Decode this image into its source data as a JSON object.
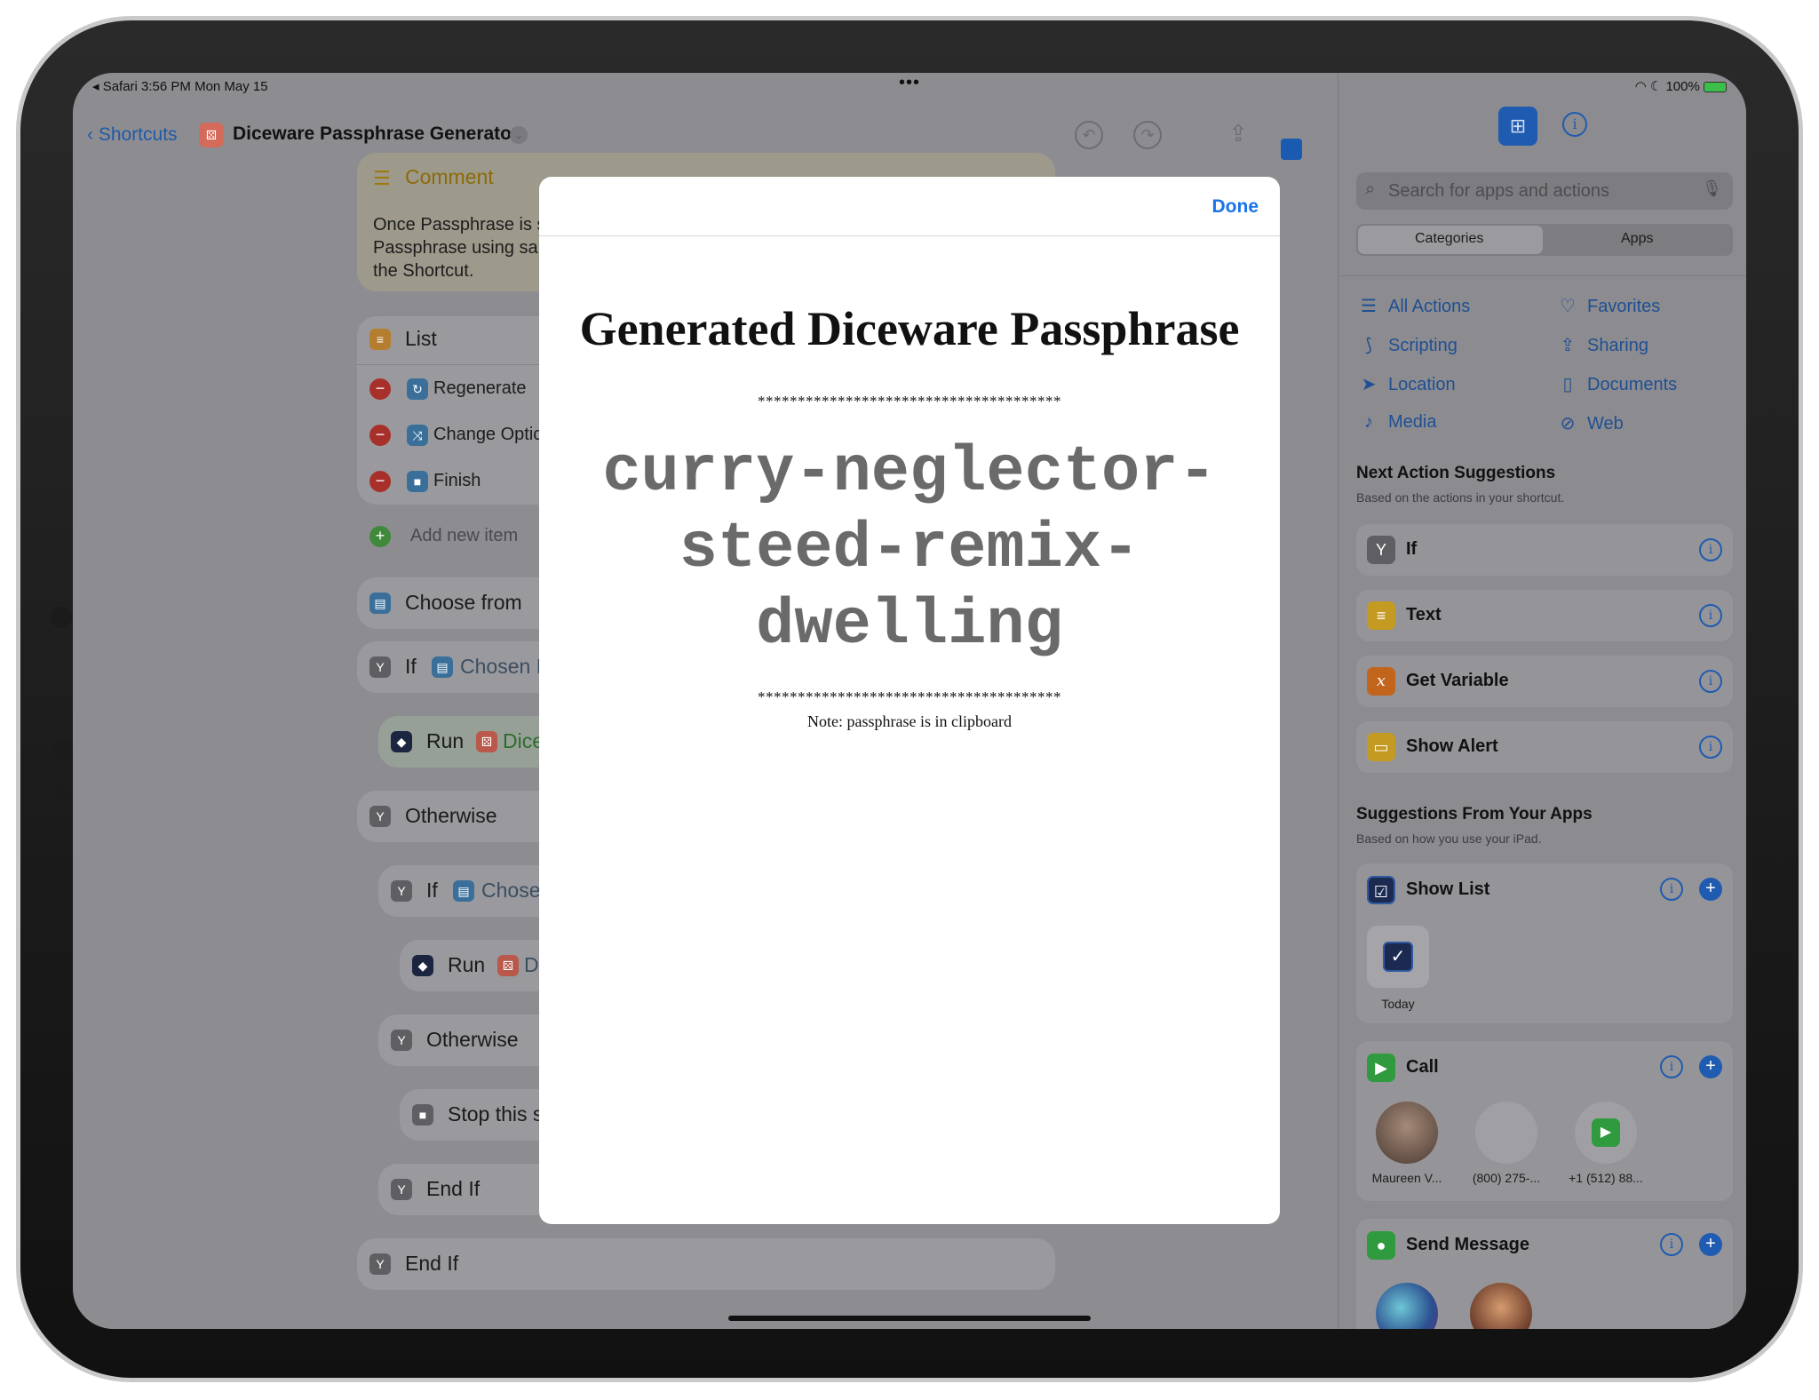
{
  "status": {
    "left": "◂ Safari   3:56 PM   Mon May 15",
    "center": "•••",
    "right": "100%"
  },
  "editor": {
    "back_label": "Shortcuts",
    "title": "Diceware Passphrase Generator",
    "comment": {
      "label": "Comment",
      "line1": "Once Passphrase is s",
      "line2": "Passphrase using sar",
      "line3": "the Shortcut."
    },
    "list": {
      "label": "List",
      "items": [
        "Regenerate",
        "Change Optic",
        "Finish"
      ],
      "add": "Add new item"
    },
    "choose_from": "Choose from",
    "if1": {
      "label": "If",
      "param": "Chosen I"
    },
    "run1": {
      "label": "Run",
      "param": "Dice"
    },
    "otherwise1": "Otherwise",
    "if2": {
      "label": "If",
      "param": "Chose"
    },
    "run2": {
      "label": "Run",
      "param": "Di"
    },
    "otherwise2": "Otherwise",
    "stop": "Stop this s",
    "endif1": "End If",
    "endif2": "End If"
  },
  "sidebar": {
    "search_placeholder": "Search for apps and actions",
    "segments": [
      "Categories",
      "Apps"
    ],
    "categories": [
      {
        "label": "All Actions",
        "icon": "list-icon"
      },
      {
        "label": "Favorites",
        "icon": "heart-icon"
      },
      {
        "label": "Scripting",
        "icon": "scripting-icon"
      },
      {
        "label": "Sharing",
        "icon": "share-icon"
      },
      {
        "label": "Location",
        "icon": "location-icon"
      },
      {
        "label": "Documents",
        "icon": "document-icon"
      },
      {
        "label": "Media",
        "icon": "music-icon"
      },
      {
        "label": "Web",
        "icon": "compass-icon"
      }
    ],
    "next_title": "Next Action Suggestions",
    "next_sub": "Based on the actions in your shortcut.",
    "next": [
      "If",
      "Text",
      "Get Variable",
      "Show Alert"
    ],
    "apps_title": "Suggestions From Your Apps",
    "apps_sub": "Based on how you use your iPad.",
    "show_list": {
      "label": "Show List",
      "item": "Today"
    },
    "call": {
      "label": "Call",
      "people": [
        "Maureen V...",
        "(800) 275-...",
        "+1 (512) 88..."
      ]
    },
    "send_message": {
      "label": "Send Message"
    }
  },
  "modal": {
    "done": "Done",
    "title": "Generated Diceware Passphrase",
    "stars_top": "**************************************",
    "passphrase_l1": "curry-neglector-",
    "passphrase_l2": "steed-remix-",
    "passphrase_l3": "dwelling",
    "stars_bottom": "**************************************",
    "note": "Note: passphrase is in clipboard"
  }
}
